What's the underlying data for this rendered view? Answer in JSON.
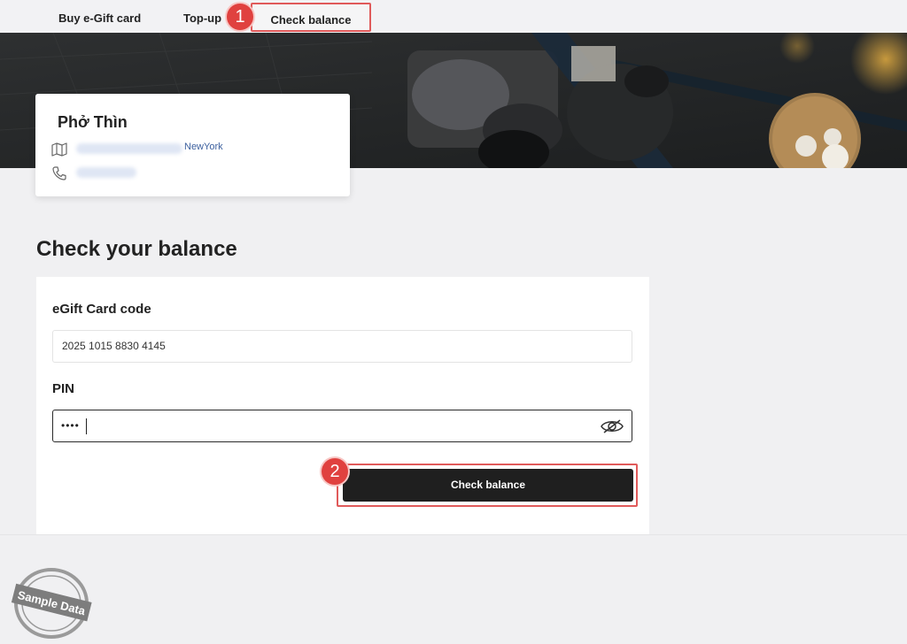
{
  "tabs": {
    "buy": "Buy e-Gift card",
    "topup": "Top-up",
    "check": "Check balance"
  },
  "steps": {
    "one": "1",
    "two": "2"
  },
  "store": {
    "name": "Phở Thìn",
    "city": "NewYork"
  },
  "page": {
    "heading": "Check your balance"
  },
  "form": {
    "code_label": "eGift Card code",
    "code_value": "2025 1015 8830 4145",
    "pin_label": "PIN",
    "pin_masked": "••••",
    "submit_label": "Check balance"
  },
  "watermark": "Sample Data",
  "colors": {
    "highlight": "#e05a5a",
    "badge": "#e0413f",
    "button": "#1f1f1f",
    "link": "#3b5f9e"
  },
  "icons": [
    "map-icon",
    "phone-icon",
    "eye-off-icon"
  ]
}
